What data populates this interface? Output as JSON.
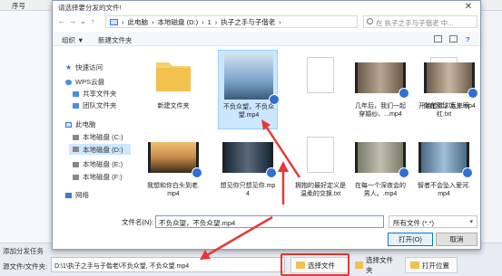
{
  "host": {
    "column_header": "序号",
    "add_task_label": "添加分发任务",
    "source_label": "源文件/文件夹:",
    "source_path": "D:\\1\\执子之手与子偕老\\不负众望, 不负众望.mp4",
    "buttons": {
      "select_file": "选择文件",
      "select_folder": "选择文件夹",
      "open_location": "打开位置"
    }
  },
  "dialog": {
    "title": "请选择要分发的文件!",
    "breadcrumb": [
      "此电脑",
      "本地磁盘 (D:)",
      "1",
      "执子之手与子偕老"
    ],
    "search_placeholder": "在 执子之手与子偕老 中...",
    "toolbar": {
      "organize": "组织 ▼",
      "new_folder": "新建文件夹"
    },
    "nav": [
      {
        "label": "快速访问",
        "icon": "star-icon"
      },
      {
        "label": "WPS云盘",
        "icon": "cloud-icon"
      },
      {
        "label": "共享文件夹",
        "icon": "share-folder-icon"
      },
      {
        "label": "团队文件夹",
        "icon": "team-folder-icon"
      },
      {
        "label": "此电脑",
        "icon": "computer-icon"
      },
      {
        "label": "本地磁盘 (C:)",
        "icon": "drive-icon"
      },
      {
        "label": "本地磁盘 (D:)",
        "icon": "drive-icon",
        "selected": true
      },
      {
        "label": "本地磁盘 (E:)",
        "icon": "drive-icon"
      },
      {
        "label": "本地磁盘 (F:)",
        "icon": "drive-icon"
      },
      {
        "label": "网络",
        "icon": "network-icon"
      }
    ],
    "files": [
      {
        "name": "新建文件夹",
        "kind": "folder"
      },
      {
        "name": "不负众望，不负众望.mp4",
        "kind": "video",
        "selected": true,
        "color": "#7aa3c9"
      },
      {
        "name": "",
        "kind": "doc"
      },
      {
        "name": "几年后，我们一起穿婚纱、...mp4",
        "kind": "video",
        "color": "#8a7a6a"
      },
      {
        "name": "开始脸红，后来眼红.txt",
        "kind": "doc"
      },
      {
        "name": "你在篮球场上.mp4",
        "kind": "video",
        "color": "#9a8b7a"
      },
      {
        "name": "我想和你白头到老.mp4",
        "kind": "video",
        "color": "#c8884a"
      },
      {
        "name": "想见你只想见你.mp4",
        "kind": "video",
        "color": "#3a4a5a"
      },
      {
        "name": "拥抱的最好定义是温柔的交换.txt",
        "kind": "doc"
      },
      {
        "name": "在每一个深夜会的男人。.mp4",
        "kind": "video",
        "color": "#9a9a8a"
      },
      {
        "name": "智者不会坠入爱河.mp4",
        "kind": "video",
        "color": "#6a8aa6"
      }
    ],
    "filename_label": "文件名(N):",
    "filename_value": "不负众望，不负众望.mp4",
    "filter_value": "所有文件 (*.*)",
    "open_button": "打开(O)",
    "cancel_button": "取消"
  },
  "colors": {
    "accent": "#0078d7",
    "annotation_red": "#e53935",
    "selection": "#cce6ff"
  }
}
